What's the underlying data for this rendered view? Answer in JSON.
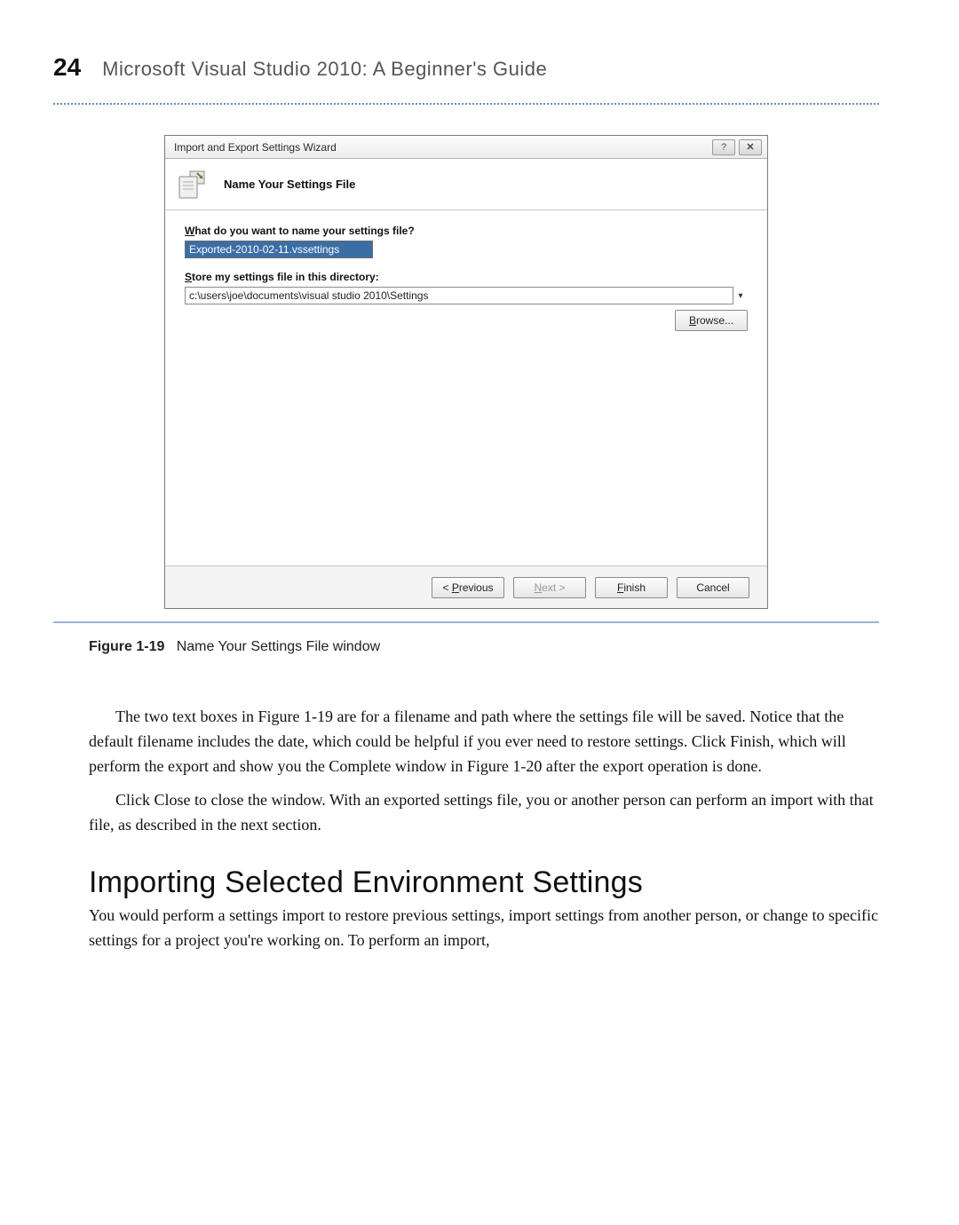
{
  "header": {
    "page_number": "24",
    "book_title": "Microsoft Visual Studio 2010: A Beginner's Guide"
  },
  "wizard": {
    "title": "Import and Export Settings Wizard",
    "help_btn": "?",
    "close_btn": "✕",
    "heading": "Name Your Settings File",
    "filename_label_pre": "W",
    "filename_label_rest": "hat do you want to name your settings file?",
    "filename_value": "Exported-2010-02-11.vssettings",
    "dir_label_pre": "S",
    "dir_label_rest": "tore my settings file in this directory:",
    "dir_value": "c:\\users\\joe\\documents\\visual studio 2010\\Settings",
    "browse_label": "Browse...",
    "buttons": {
      "previous": "< Previous",
      "next": "Next >",
      "finish": "Finish",
      "cancel": "Cancel"
    }
  },
  "figure": {
    "label": "Figure 1-19",
    "caption": "Name Your Settings File window"
  },
  "paragraphs": {
    "p1": "The two text boxes in Figure 1-19 are for a filename and path where the settings file will be saved. Notice that the default filename includes the date, which could be helpful if you ever need to restore settings. Click Finish, which will perform the export and show you the Complete window in Figure 1-20 after the export operation is done.",
    "p2": "Click Close to close the window. With an exported settings file, you or another person can perform an import with that file, as described in the next section."
  },
  "section_heading": "Importing Selected Environment Settings",
  "section_body": "You would perform a settings import to restore previous settings, import settings from another person, or change to specific settings for a project you're working on. To perform an import,"
}
